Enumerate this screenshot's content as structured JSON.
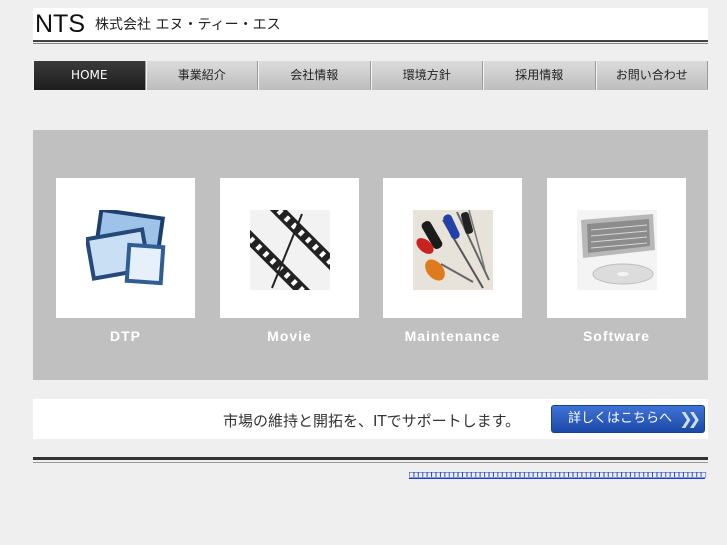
{
  "header": {
    "logo": "NTS",
    "company": "株式会社 エヌ・ティー・エス"
  },
  "nav": {
    "items": [
      {
        "label": "HOME",
        "active": true
      },
      {
        "label": "事業紹介",
        "active": false
      },
      {
        "label": "会社情報",
        "active": false
      },
      {
        "label": "環境方針",
        "active": false
      },
      {
        "label": "採用情報",
        "active": false
      },
      {
        "label": "お問い合わせ",
        "active": false
      }
    ]
  },
  "services": [
    {
      "label": "DTP",
      "icon": "dtp-photo-icon"
    },
    {
      "label": "Movie",
      "icon": "film-strip-icon"
    },
    {
      "label": "Maintenance",
      "icon": "screwdriver-icon"
    },
    {
      "label": "Software",
      "icon": "laptop-disc-icon"
    }
  ],
  "tagbar": {
    "tagline": "市場の維持と開拓を、ITでサポートします。",
    "button_label": "詳しくはこちらへ",
    "button_arrows": "❯❯"
  },
  "footer": {
    "links_text": "□□□□□□□□□□□□□□□□□□□□□□□□□□□□□□□□□□□□□□□□□□□□□□□□□□□□□□□□□□□□□□□□□□□"
  },
  "colors": {
    "page_bg": "#efefef",
    "panel_bg": "#c0c0c0",
    "button_blue": "#2a5cc0",
    "link_blue": "#1a3fd0"
  }
}
